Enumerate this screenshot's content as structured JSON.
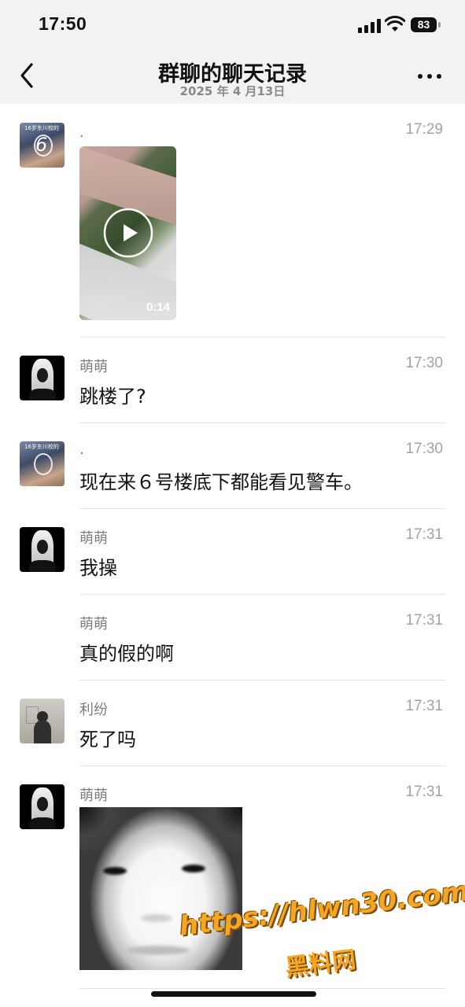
{
  "status_bar": {
    "time": "17:50",
    "battery": "83"
  },
  "header": {
    "title": "群聊的聊天记录",
    "subtitle": "2025 年 4 月13日"
  },
  "messages": [
    {
      "sender": ".",
      "time": "17:29",
      "video_duration": "0:14",
      "avatar_text": "6"
    },
    {
      "sender": "萌萌",
      "time": "17:30",
      "text": "跳楼了?"
    },
    {
      "sender": ".",
      "time": "17:30",
      "text": "现在来６号楼底下都能看见警车。"
    },
    {
      "sender": "萌萌",
      "time": "17:31",
      "text": "我操"
    },
    {
      "sender": "萌萌",
      "time": "17:31",
      "text": "真的假的啊"
    },
    {
      "sender": "利纷",
      "time": "17:31",
      "text": "死了吗"
    },
    {
      "sender": "萌萌",
      "time": "17:31"
    }
  ],
  "watermark": {
    "url": "https://hlwn30.com",
    "name": "黑料网"
  },
  "colors": {
    "header_bg": "#f2f2f2",
    "divider": "#e2e2e2",
    "watermark": "#f5a623"
  },
  "icons": [
    "back-chevron-icon",
    "more-icon",
    "play-icon",
    "signal-icon",
    "wifi-icon",
    "battery-icon"
  ]
}
